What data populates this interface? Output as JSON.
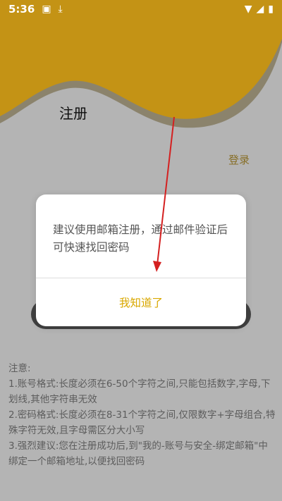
{
  "status_bar": {
    "time": "5:36",
    "icons": [
      "image-icon",
      "download-icon",
      "wifi-icon",
      "signal-icon",
      "battery-icon"
    ]
  },
  "page": {
    "title": "注册",
    "login_link": "登录",
    "notes": {
      "heading": "注意:",
      "items": [
        "1.账号格式:长度必须在6-50个字符之间,只能包括数字,字母,下划线,其他字符串无效",
        "2.密码格式:长度必须在8-31个字符之间,仅限数字+字母组合,特殊字符无效,且字母需区分大小写",
        "3.强烈建议:您在注册成功后,到\"我的-账号与安全-绑定邮箱\"中绑定一个邮箱地址,以便找回密码"
      ]
    }
  },
  "dialog": {
    "message": "建议使用邮箱注册，通过邮件验证后可快速找回密码",
    "confirm_label": "我知道了"
  },
  "colors": {
    "accent": "#d9a800",
    "header_wave": "#e0a818",
    "annotation_arrow": "#d42020"
  }
}
